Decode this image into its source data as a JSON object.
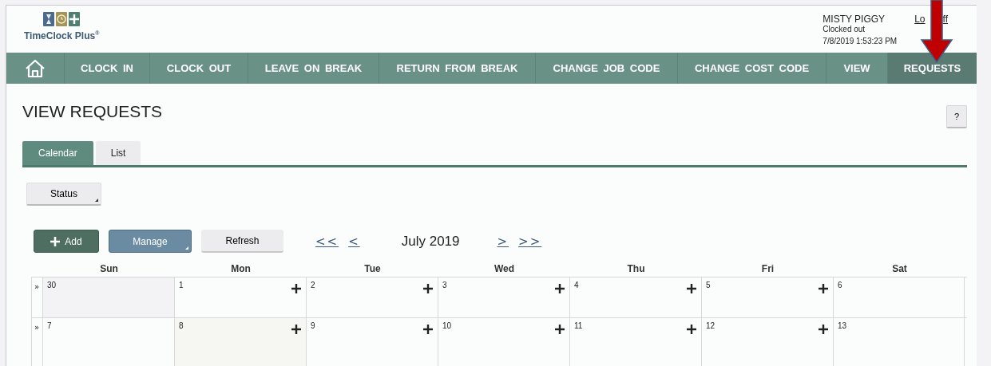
{
  "header": {
    "logo_text": "TimeClock Plus",
    "logo_mark": "®",
    "user_name": "MISTY PIGGY",
    "status": "Clocked out",
    "datetime": "7/8/2019  1:53:23 PM",
    "logout": [
      "Lo",
      "ff"
    ]
  },
  "nav": [
    {
      "kind": "home",
      "selected": false
    },
    {
      "label": "CLOCK IN",
      "selected": false
    },
    {
      "label": "CLOCK OUT",
      "selected": false
    },
    {
      "label": "LEAVE ON BREAK",
      "selected": false
    },
    {
      "label": "RETURN FROM BREAK",
      "selected": false
    },
    {
      "label": "CHANGE JOB CODE",
      "selected": false
    },
    {
      "label": "CHANGE COST CODE",
      "selected": false
    },
    {
      "label": "VIEW",
      "selected": false
    },
    {
      "label": "REQUESTS",
      "selected": true
    }
  ],
  "page_title": "VIEW REQUESTS",
  "help": "?",
  "tabs": [
    {
      "label": "Calendar",
      "selected": true
    },
    {
      "label": "List",
      "selected": false
    }
  ],
  "status_filter": "Status",
  "toolbar": {
    "add": "Add",
    "manage": "Manage",
    "refresh": "Refresh",
    "first": "<<",
    "prev": "<",
    "month": "July 2019",
    "next": ">",
    "last": ">>"
  },
  "weekdays": [
    "Sun",
    "Mon",
    "Tue",
    "Wed",
    "Thu",
    "Fri",
    "Sat"
  ],
  "weeks": [
    {
      "expander": "»",
      "days": [
        {
          "label": "30",
          "kind": "other-month",
          "add": false
        },
        {
          "label": "1",
          "kind": "normal",
          "add": true
        },
        {
          "label": "2",
          "kind": "normal",
          "add": true
        },
        {
          "label": "3",
          "kind": "normal",
          "add": true
        },
        {
          "label": "4",
          "kind": "normal",
          "add": true
        },
        {
          "label": "5",
          "kind": "normal",
          "add": true
        },
        {
          "label": "6",
          "kind": "normal",
          "add": false
        }
      ]
    },
    {
      "expander": "»",
      "days": [
        {
          "label": "7",
          "kind": "normal",
          "add": false
        },
        {
          "label": "8",
          "kind": "today",
          "add": true
        },
        {
          "label": "9",
          "kind": "normal",
          "add": true
        },
        {
          "label": "10",
          "kind": "normal",
          "add": true
        },
        {
          "label": "11",
          "kind": "normal",
          "add": true
        },
        {
          "label": "12",
          "kind": "normal",
          "add": true
        },
        {
          "label": "13",
          "kind": "normal",
          "add": false
        }
      ]
    }
  ]
}
